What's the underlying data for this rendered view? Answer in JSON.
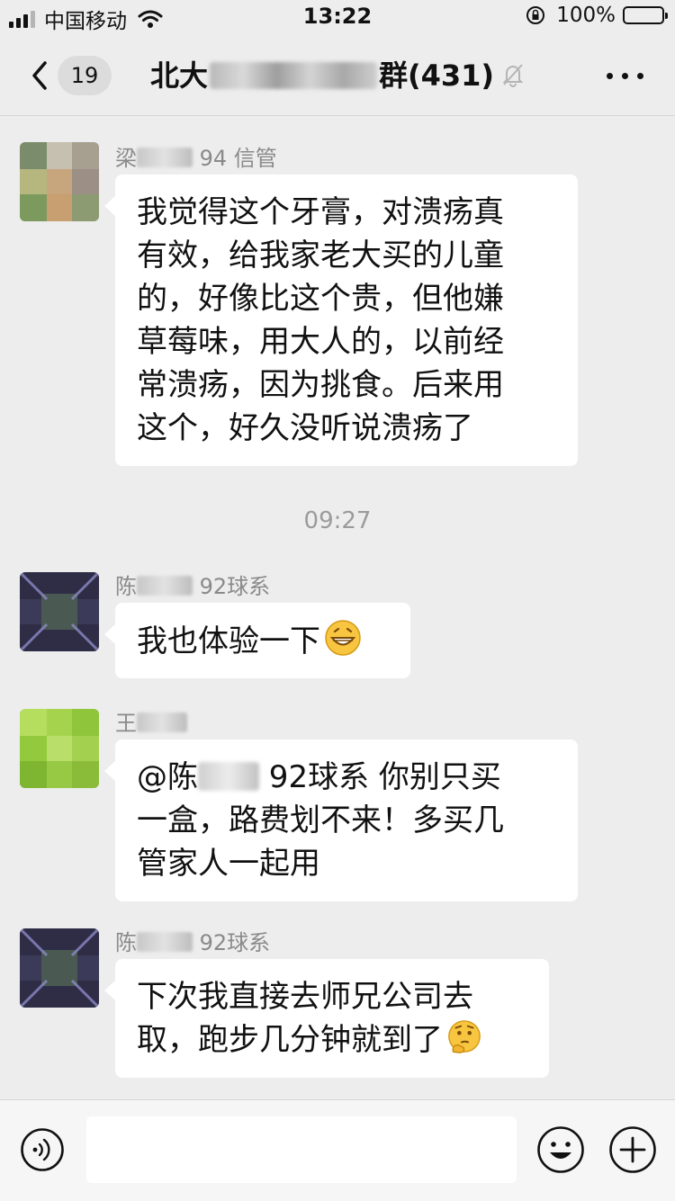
{
  "status_bar": {
    "carrier": "中国移动",
    "time": "13:22",
    "battery": "100%"
  },
  "nav": {
    "unread_count": "19",
    "title_prefix": "北大",
    "title_suffix": "群(431)"
  },
  "messages": [
    {
      "sender_surname": "梁",
      "sender_tag": "94 信管",
      "lines": [
        "我觉得这个牙膏，对溃疡真",
        "有效，给我家老大买的儿童",
        "的，好像比这个贵，但他嫌",
        "草莓味，用大人的，以前经",
        "常溃疡，因为挑食。后来用",
        "这个，好久没听说溃疡了"
      ]
    },
    {
      "time_separator": "09:27"
    },
    {
      "sender_surname": "陈",
      "sender_tag": "92球系",
      "text": "我也体验一下",
      "emoji": "grinning-emoji"
    },
    {
      "sender_surname": "王",
      "sender_tag": "",
      "mention_prefix": "@陈",
      "mention_suffix": " 92球系 你别只买",
      "lines": [
        "一盒，路费划不来！多买几",
        "管家人一起用"
      ]
    },
    {
      "sender_surname": "陈",
      "sender_tag": "92球系",
      "line1": "下次我直接去师兄公司去",
      "line2": "取，跑步几分钟就到了",
      "emoji": "thinking-face-emoji"
    }
  ],
  "input_bar": {
    "placeholder": ""
  },
  "colors": {
    "background": "#ededed",
    "bubble": "#ffffff",
    "meta_text": "#8a8a8a",
    "input_bar": "#f6f6f6"
  }
}
